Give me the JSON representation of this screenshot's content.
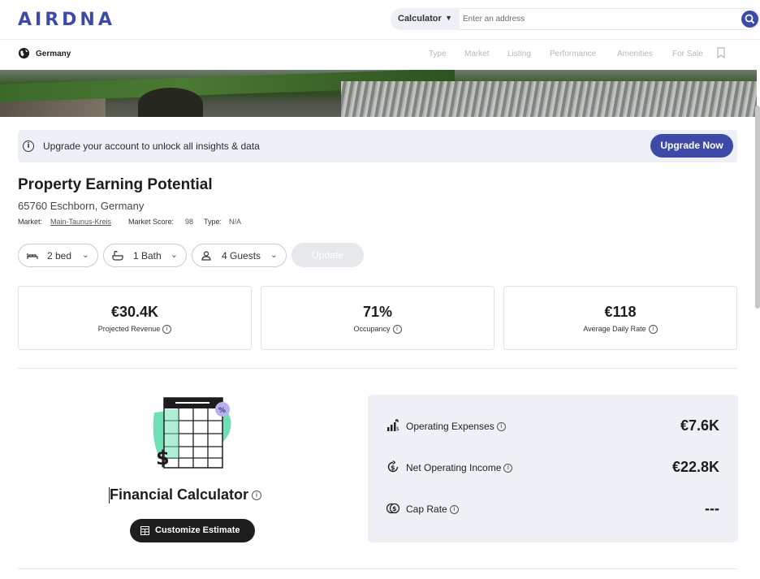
{
  "header": {
    "logo": "AIRDNA",
    "search": {
      "type_label": "Calculator",
      "placeholder": "Enter an address"
    }
  },
  "subnav": {
    "country": "Germany",
    "items": [
      "Type",
      "Market",
      "Listing",
      "Performance",
      "Amenities",
      "For Sale"
    ]
  },
  "upgrade": {
    "text": "Upgrade your account to unlock all insights & data",
    "button": "Upgrade Now"
  },
  "property": {
    "title": "Property Earning Potential",
    "address": "65760 Eschborn, Germany",
    "market_label": "Market:",
    "market_value": "Main-Taunus-Kreis",
    "score_label": "Market Score:",
    "score_value": "98",
    "type_label": "Type:",
    "type_value": "N/A"
  },
  "filters": {
    "bed": "2 bed",
    "bath": "1 Bath",
    "guests": "4 Guests",
    "update": "Update"
  },
  "stats": [
    {
      "value": "€30.4K",
      "label": "Projected Revenue"
    },
    {
      "value": "71%",
      "label": "Occupancy"
    },
    {
      "value": "€118",
      "label": "Average Daily Rate"
    }
  ],
  "calculator": {
    "title": "Financial Calculator",
    "button": "Customize Estimate"
  },
  "metrics": [
    {
      "label": "Operating Expenses",
      "value": "€7.6K"
    },
    {
      "label": "Net Operating Income",
      "value": "€22.8K"
    },
    {
      "label": "Cap Rate",
      "value": "---"
    }
  ],
  "colors": {
    "brand": "#3d4aa8",
    "accent_green": "#6fe0b4",
    "panel_bg": "#eef0f5"
  }
}
